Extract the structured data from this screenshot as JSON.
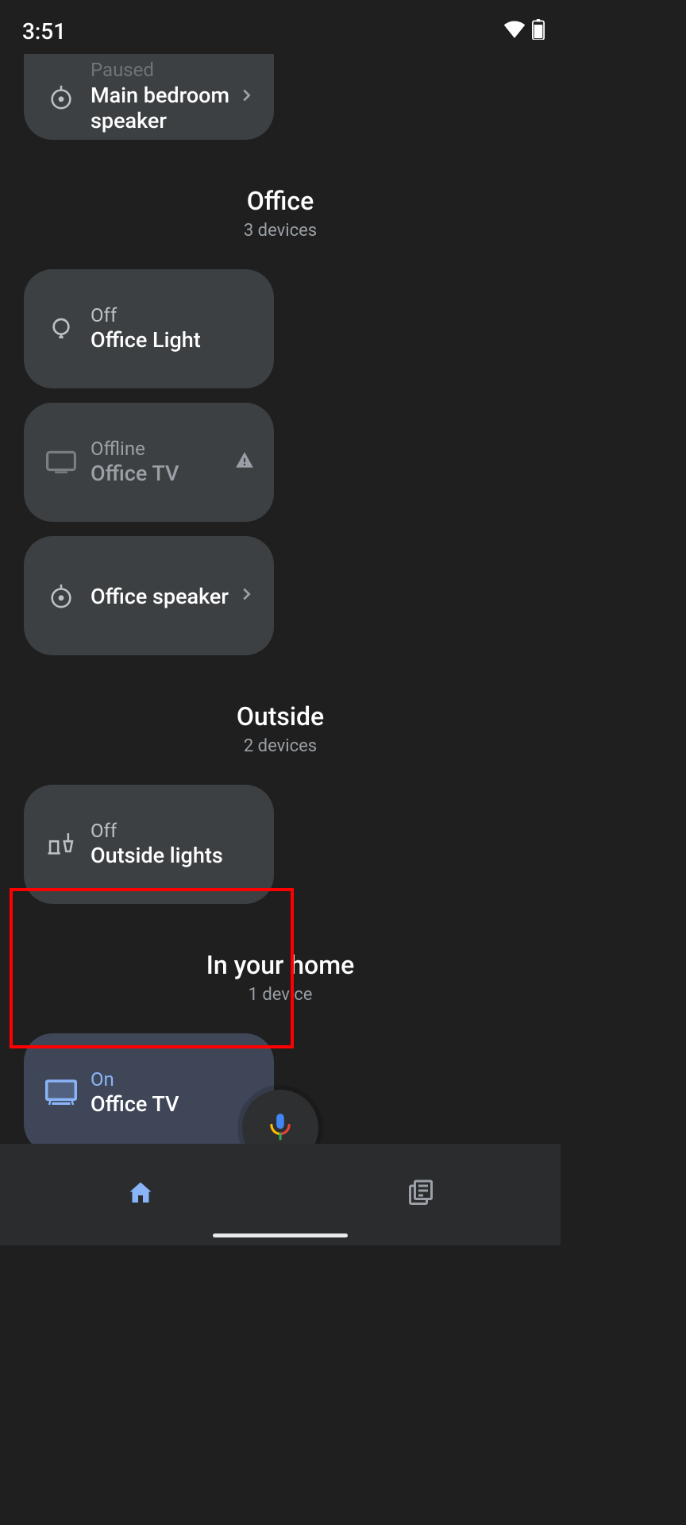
{
  "status_bar": {
    "time": "3:51"
  },
  "sections": {
    "partial_card": {
      "status": "Paused",
      "name": "Main bedroom speaker"
    },
    "office": {
      "title": "Office",
      "subtitle": "3 devices",
      "cards": [
        {
          "status": "Off",
          "name": "Office Light"
        },
        {
          "status": "Offline",
          "name": "Office TV"
        },
        {
          "name": "Office speaker"
        }
      ]
    },
    "outside": {
      "title": "Outside",
      "subtitle": "2 devices",
      "cards": [
        {
          "status": "Off",
          "name": "Outside lights"
        }
      ]
    },
    "in_home": {
      "title": "In your home",
      "subtitle": "1 device",
      "cards": [
        {
          "status": "On",
          "name": "Office TV"
        }
      ]
    }
  }
}
